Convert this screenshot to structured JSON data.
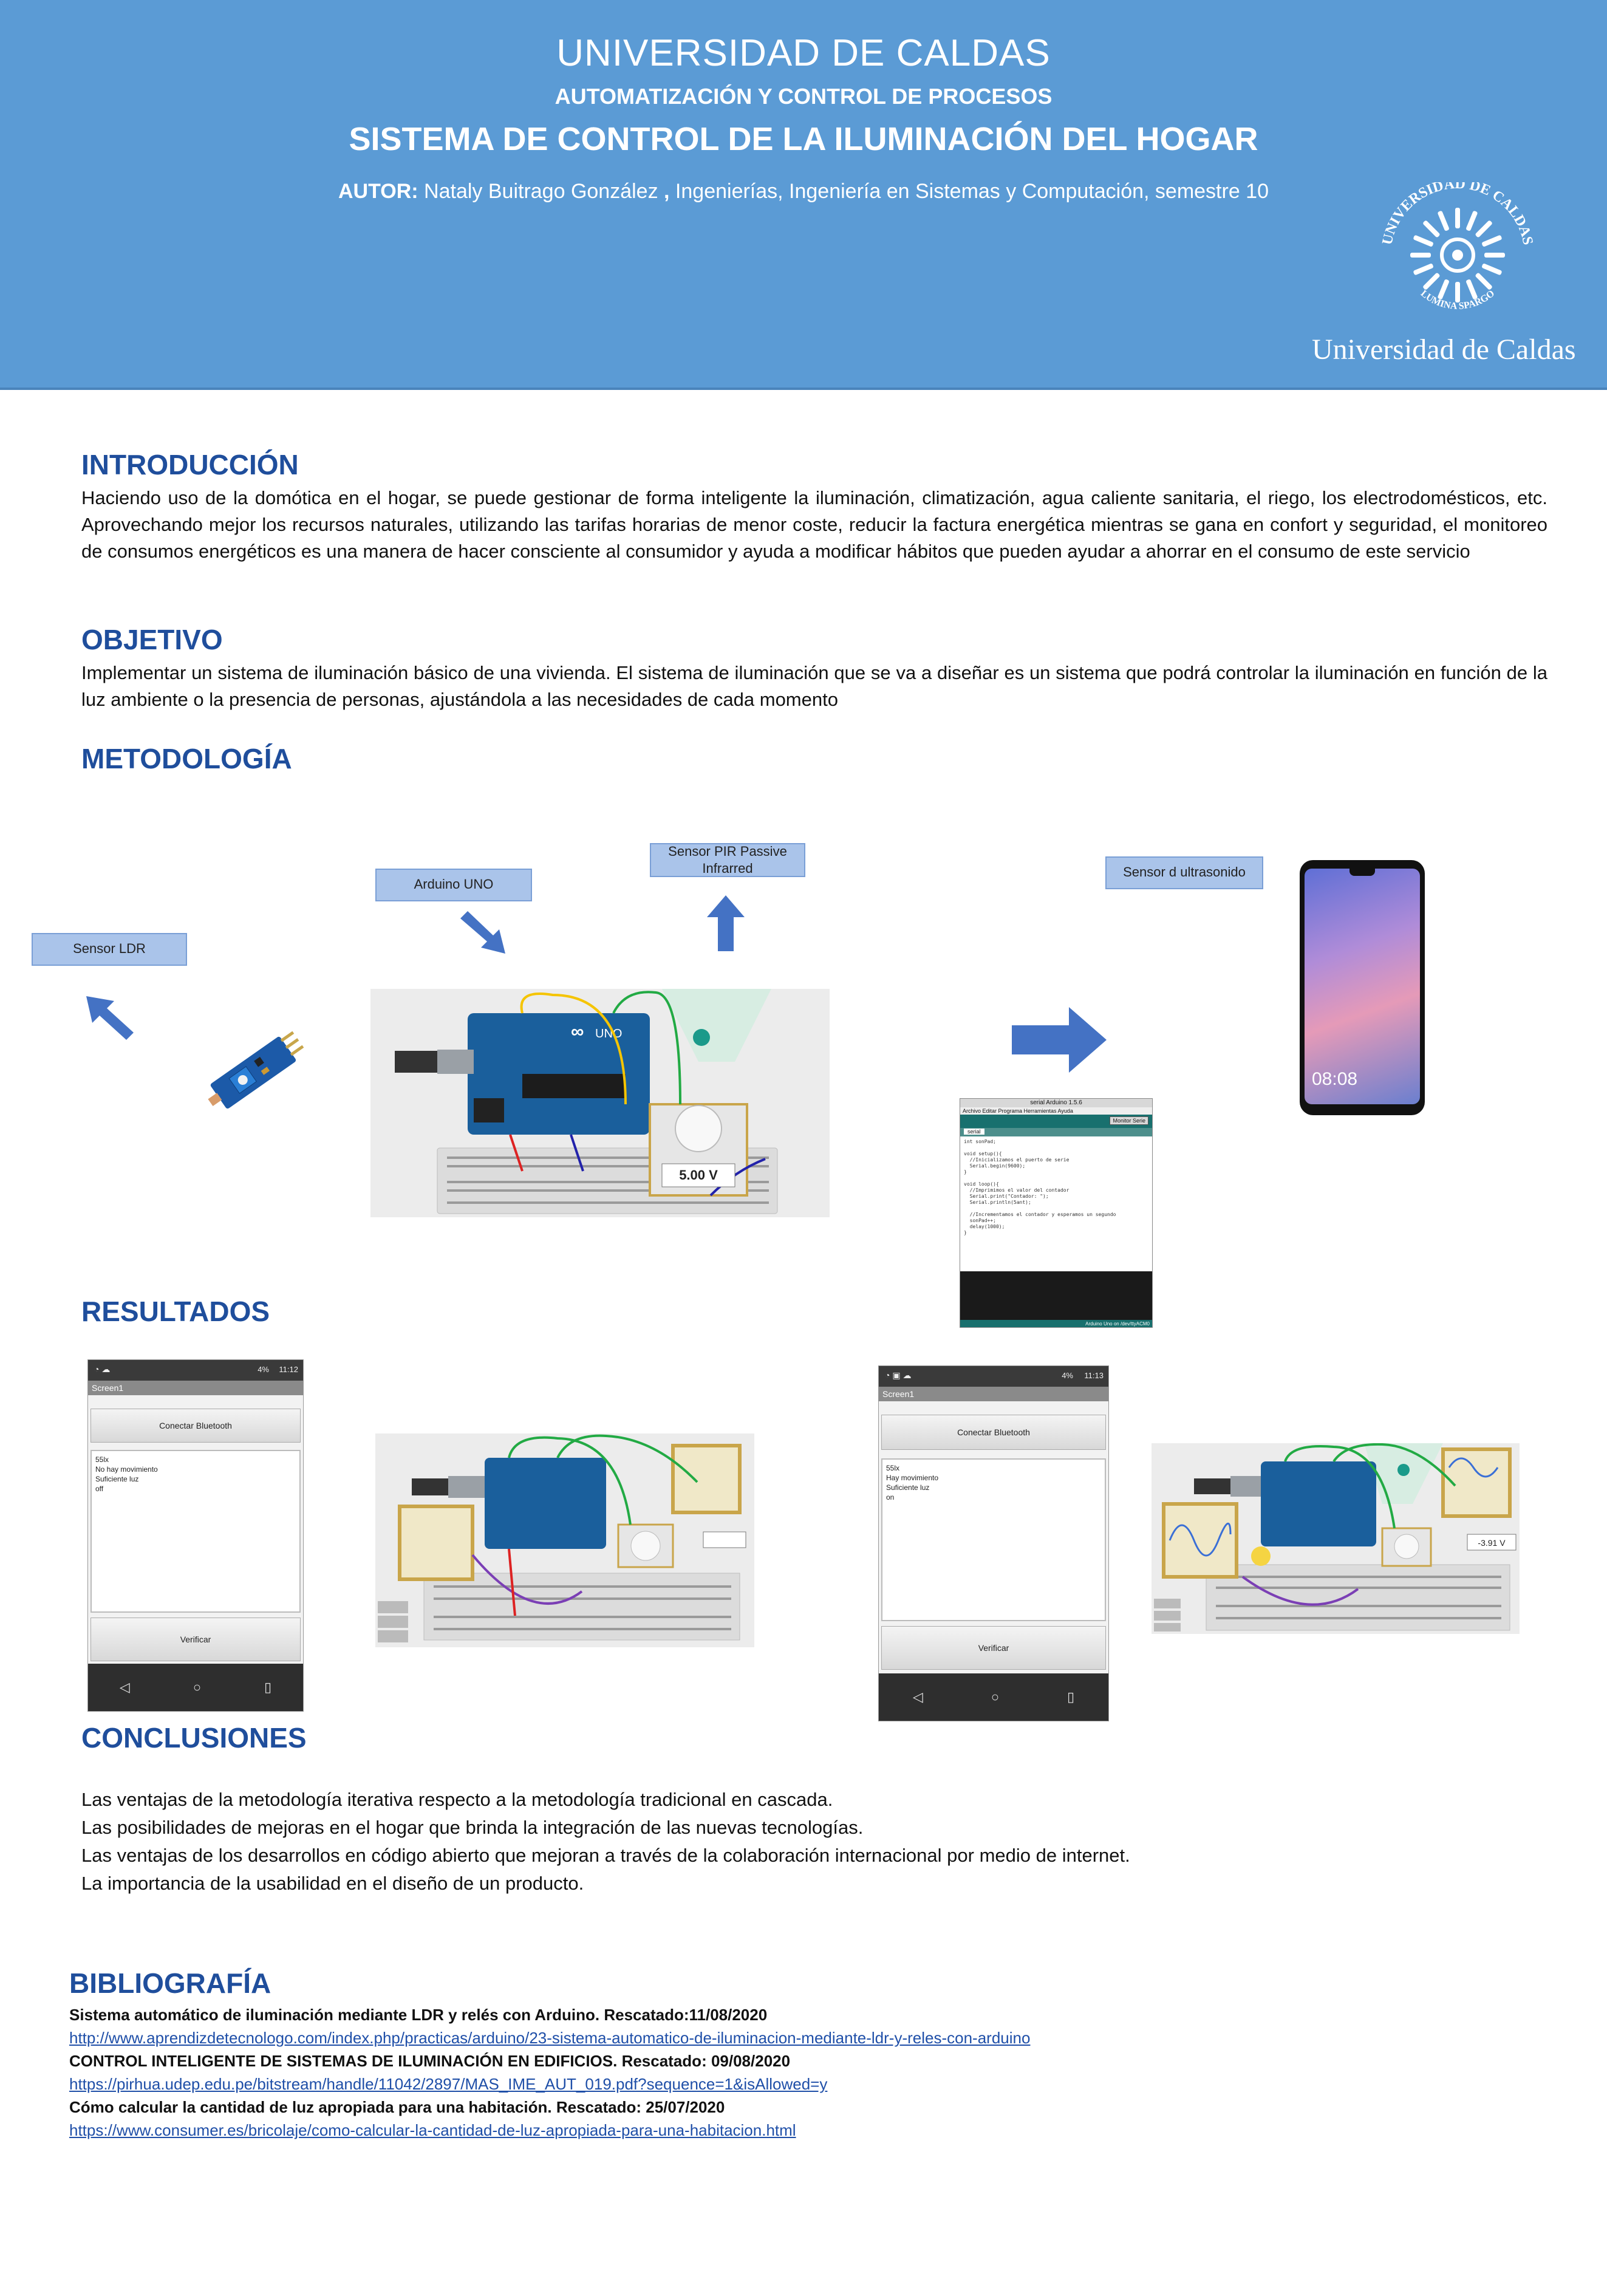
{
  "header": {
    "university": "UNIVERSIDAD DE CALDAS",
    "program": "AUTOMATIZACIÓN Y CONTROL DE PROCESOS",
    "title": "SISTEMA DE CONTROL DE LA ILUMINACIÓN DEL HOGAR",
    "author_label": "AUTOR:",
    "author_name": " Nataly Buitrago González ",
    "author_comma": ",",
    "author_rest": " Ingenierías, Ingeniería en Sistemas y Computación, semestre 10",
    "logo_text": "Universidad de Caldas",
    "logo_ring_top": "UNIVERSIDAD DE CALDAS",
    "logo_ring_bottom": "LUMINA SPARGO"
  },
  "intro": {
    "heading": "INTRODUCCIÓN",
    "text": "Haciendo uso de la domótica en el hogar, se puede gestionar de forma inteligente la iluminación, climatización, agua caliente sanitaria, el riego, los electrodomésticos, etc. Aprovechando mejor los recursos naturales, utilizando las tarifas horarias de menor coste, reducir la factura energética mientras se gana en confort y seguridad, el monitoreo de consumos energéticos es una manera de hacer consciente al consumidor y ayuda a modificar hábitos que pueden ayudar a ahorrar en el consumo de este servicio"
  },
  "objetivo": {
    "heading": "OBJETIVO",
    "text": "Implementar un sistema de iluminación básico de una vivienda. El sistema de iluminación que se va a diseñar es un sistema que podrá controlar la iluminación en función de la luz ambiente o la presencia de personas, ajustándola a las necesidades de cada momento"
  },
  "metodologia": {
    "heading": "METODOLOGÍA",
    "labels": {
      "ldr": "Sensor LDR",
      "arduino": "Arduino UNO",
      "pir": "Sensor PIR Passive Infrarred",
      "ultra": "Sensor d ultrasonido"
    },
    "voltage": "5.00 V",
    "phone_time": "08:08",
    "serial_title": "serial Arduino 1.5.6",
    "serial_menu": "Archivo  Editar  Programa  Herramientas  Ayuda",
    "serial_button": "Monitor Serie",
    "serial_tab": "serial",
    "serial_code": [
      "int sonPad;",
      "",
      "void setup(){",
      "  //Inicializamos el puerto de serie",
      "  Serial.begin(9600);",
      "}",
      "",
      "void loop(){",
      "  //Imprimimos el valor del contador",
      "  Serial.print(\"Contador: \");",
      "  Serial.println(5ant);",
      "",
      "  //Incrementamos el contador y esperamos un segundo",
      "  sonPad++;",
      "  delay(1000);",
      "}"
    ],
    "serial_footer": "Arduino Uno on /dev/ttyACM0"
  },
  "resultados": {
    "heading": "RESULTADOS",
    "phone1": {
      "time": "11:12",
      "battery": "4%",
      "screen": "Screen1",
      "connect": "Conectar Bluetooth",
      "lines": [
        "55lx",
        "No hay movimiento",
        "Suficiente luz",
        "off"
      ],
      "verify": "Verificar"
    },
    "phone2": {
      "time": "11:13",
      "battery": "4%",
      "screen": "Screen1",
      "connect": "Conectar Bluetooth",
      "lines": [
        "55lx",
        "Hay movimiento",
        "Suficiente luz",
        "on"
      ],
      "verify": "Verificar"
    },
    "voltage2": "-3.91 V"
  },
  "conclusiones": {
    "heading": "CONCLUSIONES",
    "items": [
      "Las ventajas de la metodología iterativa respecto a la metodología tradicional en cascada.",
      "Las posibilidades de mejoras en el hogar que brinda la integración de las nuevas tecnologías.",
      "Las ventajas de los desarrollos en código abierto que mejoran a través de la colaboración internacional por medio de internet.",
      "La importancia de la usabilidad en el diseño de un producto."
    ]
  },
  "bibliografia": {
    "heading": "BIBLIOGRAFÍA",
    "entries": [
      {
        "title": "Sistema automático de iluminación mediante LDR y relés con Arduino. Rescatado:11/08/2020",
        "url": "http://www.aprendizdetecnologo.com/index.php/practicas/arduino/23-sistema-automatico-de-iluminacion-mediante-ldr-y-reles-con-arduino"
      },
      {
        "title": "CONTROL INTELIGENTE DE SISTEMAS DE ILUMINACIÓN EN EDIFICIOS. Rescatado: 09/08/2020",
        "url": "https://pirhua.udep.edu.pe/bitstream/handle/11042/2897/MAS_IME_AUT_019.pdf?sequence=1&isAllowed=y"
      },
      {
        "title": "Cómo calcular la cantidad de luz apropiada para una habitación. Rescatado: 25/07/2020",
        "url": "https://www.consumer.es/bricolaje/como-calcular-la-cantidad-de-luz-apropiada-para-una-habitacion.html"
      }
    ]
  },
  "colors": {
    "header_bg": "#5b9bd5",
    "heading": "#1f4e9c",
    "label_bg": "#aac4ea",
    "arrow": "#4472c4"
  }
}
